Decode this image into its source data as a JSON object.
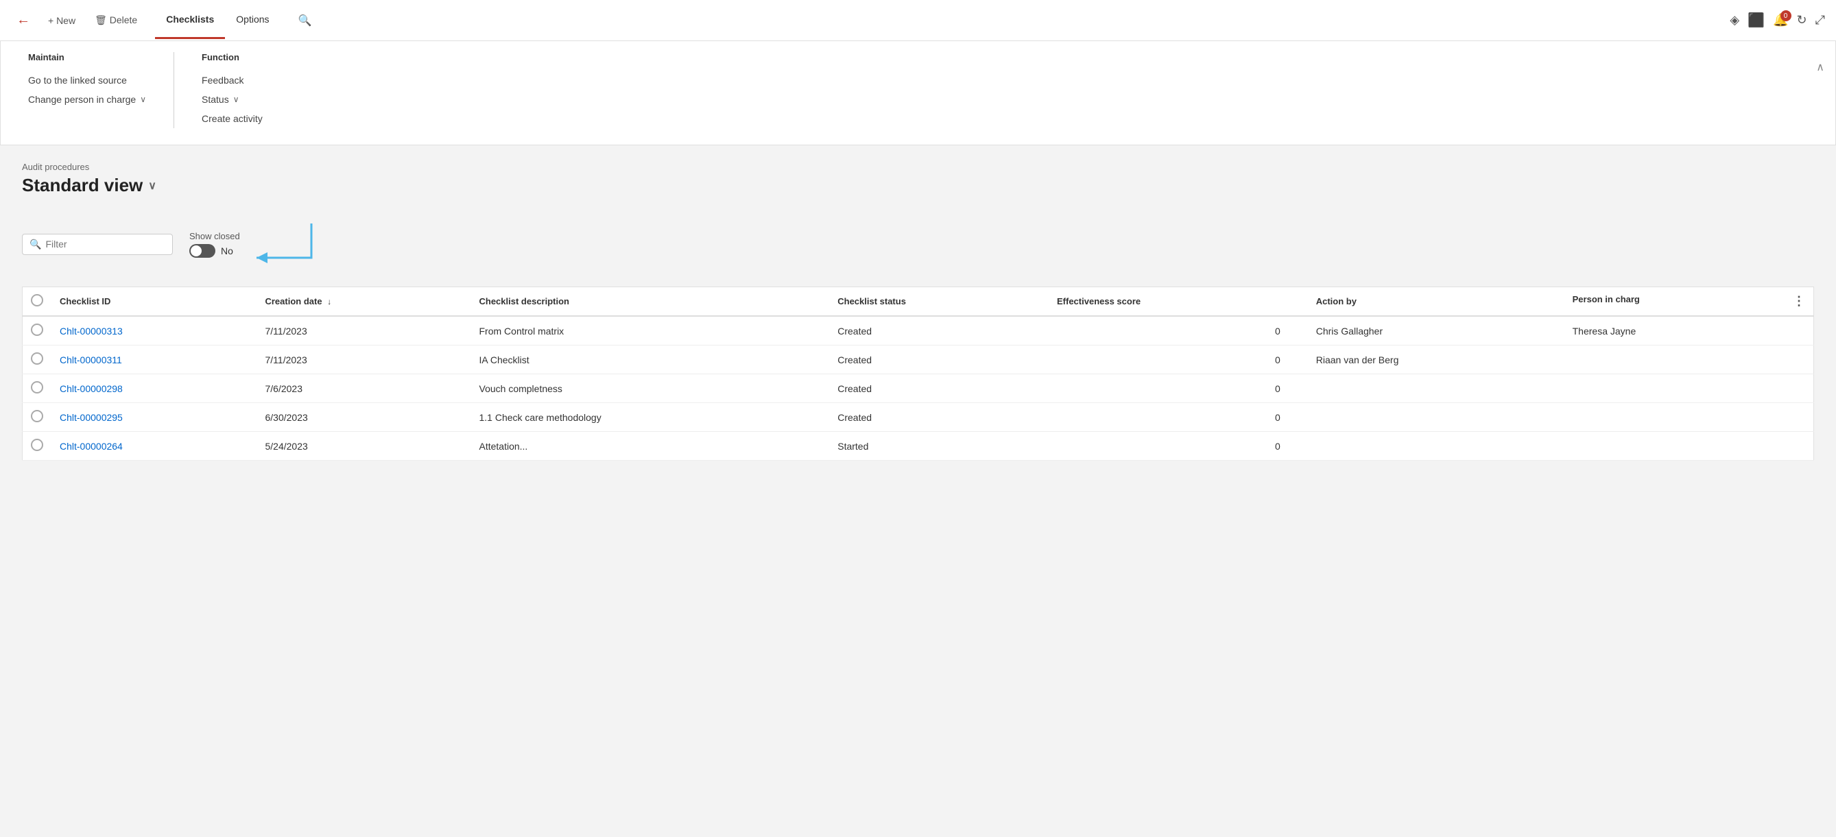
{
  "topbar": {
    "back_label": "←",
    "new_label": "+ New",
    "delete_label": "🗑 Delete",
    "tabs": [
      {
        "id": "checklists",
        "label": "Checklists",
        "active": true
      },
      {
        "id": "options",
        "label": "Options",
        "active": false
      }
    ],
    "search_icon": "🔍",
    "icons": {
      "diamond": "◇",
      "office": "⬜",
      "notifications": "🔔",
      "notification_badge": "0",
      "refresh": "↻",
      "expand": "⤢"
    }
  },
  "dropdown": {
    "maintain_title": "Maintain",
    "maintain_items": [
      {
        "label": "Go to the linked source",
        "has_chevron": false
      },
      {
        "label": "Change person in charge",
        "has_chevron": true
      }
    ],
    "function_title": "Function",
    "function_items": [
      {
        "label": "Feedback",
        "has_chevron": false
      },
      {
        "label": "Status",
        "has_chevron": true
      },
      {
        "label": "Create activity",
        "has_chevron": false
      }
    ],
    "close_icon": "∧"
  },
  "page": {
    "breadcrumb": "Audit procedures",
    "title": "Standard view",
    "title_chevron": "∨"
  },
  "filter": {
    "placeholder": "Filter",
    "show_closed_label": "Show closed",
    "toggle_value": "No"
  },
  "table": {
    "columns": [
      {
        "id": "select",
        "label": ""
      },
      {
        "id": "checklist_id",
        "label": "Checklist ID"
      },
      {
        "id": "creation_date",
        "label": "Creation date",
        "sort": "↓"
      },
      {
        "id": "checklist_description",
        "label": "Checklist description"
      },
      {
        "id": "checklist_status",
        "label": "Checklist status"
      },
      {
        "id": "effectiveness_score",
        "label": "Effectiveness score"
      },
      {
        "id": "action_by",
        "label": "Action by"
      },
      {
        "id": "person_in_charge",
        "label": "Person in charg"
      }
    ],
    "rows": [
      {
        "checklist_id": "Chlt-00000313",
        "creation_date": "7/11/2023",
        "checklist_description": "From Control matrix",
        "checklist_status": "Created",
        "effectiveness_score": "0",
        "action_by": "Chris Gallagher",
        "person_in_charge": "Theresa Jayne"
      },
      {
        "checklist_id": "Chlt-00000311",
        "creation_date": "7/11/2023",
        "checklist_description": "IA Checklist",
        "checklist_status": "Created",
        "effectiveness_score": "0",
        "action_by": "Riaan van der Berg",
        "person_in_charge": ""
      },
      {
        "checklist_id": "Chlt-00000298",
        "creation_date": "7/6/2023",
        "checklist_description": "Vouch completness",
        "checklist_status": "Created",
        "effectiveness_score": "0",
        "action_by": "",
        "person_in_charge": ""
      },
      {
        "checklist_id": "Chlt-00000295",
        "creation_date": "6/30/2023",
        "checklist_description": "1.1 Check care methodology",
        "checklist_status": "Created",
        "effectiveness_score": "0",
        "action_by": "",
        "person_in_charge": ""
      },
      {
        "checklist_id": "Chlt-00000264",
        "creation_date": "5/24/2023",
        "checklist_description": "Attetation...",
        "checklist_status": "Started",
        "effectiveness_score": "0",
        "action_by": "",
        "person_in_charge": ""
      }
    ]
  }
}
